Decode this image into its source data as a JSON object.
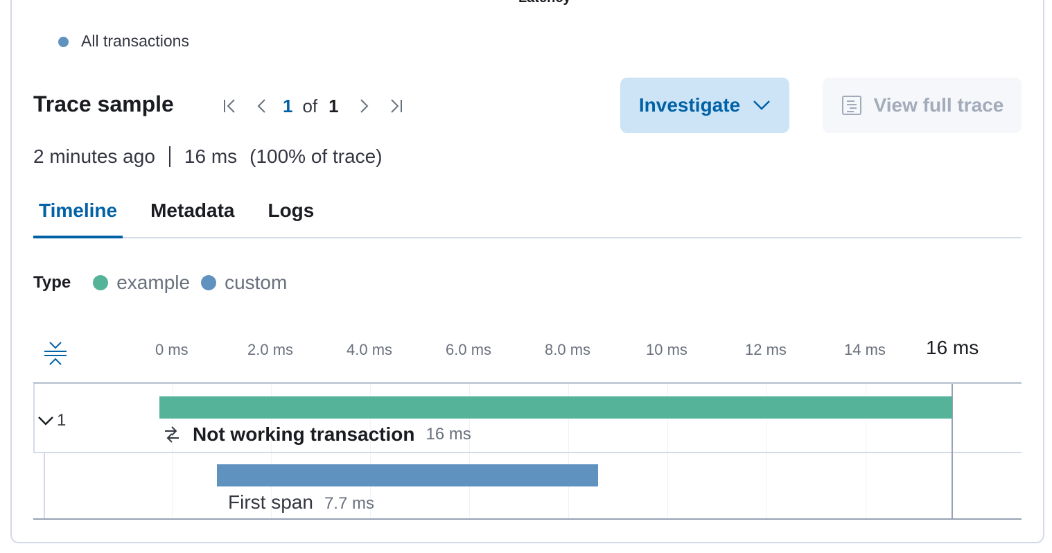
{
  "chart_header": {
    "latency_title": "Latency"
  },
  "chart_legend": {
    "series_label": "All transactions",
    "series_color": "#6092c0"
  },
  "trace": {
    "title": "Trace sample",
    "pagination": {
      "current": "1",
      "of_label": "of",
      "total": "1"
    },
    "investigate_label": "Investigate",
    "view_full_trace_label": "View full trace",
    "timestamp": "2 minutes ago",
    "duration": "16 ms",
    "percent_of_trace": "(100% of trace)"
  },
  "tabs": [
    {
      "label": "Timeline",
      "active": true
    },
    {
      "label": "Metadata",
      "active": false
    },
    {
      "label": "Logs",
      "active": false
    }
  ],
  "type_legend": {
    "label": "Type",
    "items": [
      {
        "name": "example",
        "color": "#54b399"
      },
      {
        "name": "custom",
        "color": "#6092c0"
      }
    ]
  },
  "timeline": {
    "ticks": [
      "0 ms",
      "2.0 ms",
      "4.0 ms",
      "6.0 ms",
      "8.0 ms",
      "10 ms",
      "12 ms",
      "14 ms",
      "16 ms"
    ],
    "max_ms": 16,
    "child_count": "1"
  },
  "waterfall": [
    {
      "name": "Not working transaction",
      "duration_label": "16 ms",
      "start_ms": 0,
      "duration_ms": 16,
      "type": "example",
      "color": "#54b399",
      "icon": "transaction-icon"
    },
    {
      "name": "First span",
      "duration_label": "7.7 ms",
      "start_ms": 1.16,
      "duration_ms": 7.7,
      "type": "custom",
      "color": "#6092c0"
    }
  ]
}
